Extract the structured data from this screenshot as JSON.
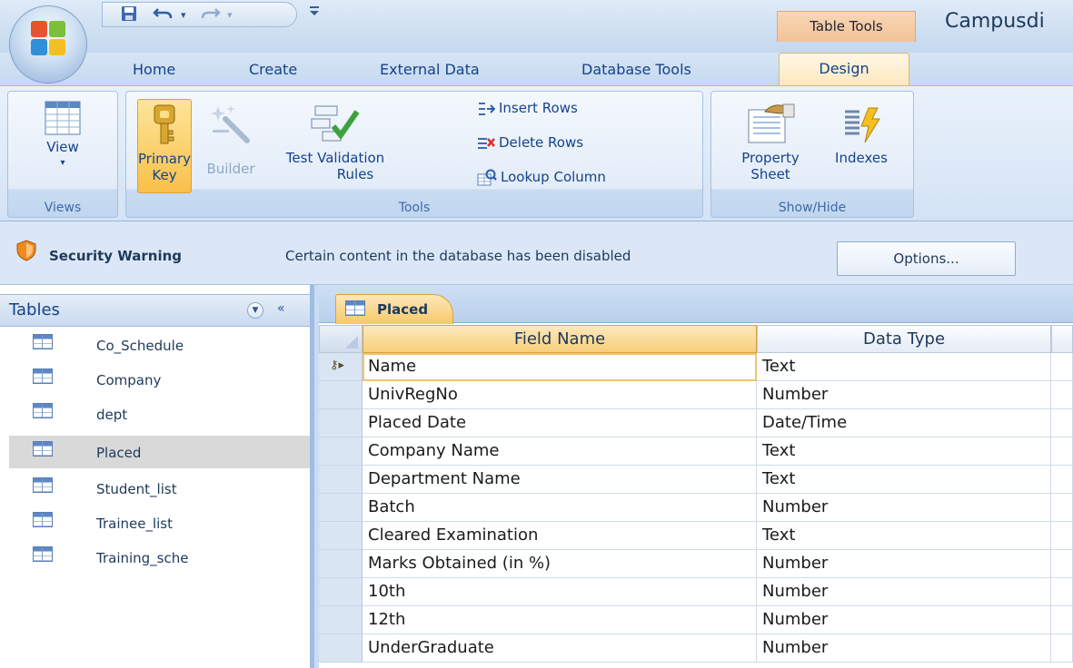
{
  "titlebar": {
    "contextual_tab": "Table Tools",
    "title": "Campusdi",
    "qat": {
      "save_icon": "save-icon",
      "undo_icon": "undo-icon",
      "redo_icon": "redo-icon",
      "customize_icon": "customize-qat-icon"
    }
  },
  "tabs": [
    {
      "label": "Home"
    },
    {
      "label": "Create"
    },
    {
      "label": "External Data"
    },
    {
      "label": "Database Tools"
    },
    {
      "label": "Design",
      "active": true
    }
  ],
  "ribbon": {
    "views": {
      "label": "Views",
      "view": "View"
    },
    "tools": {
      "label": "Tools",
      "primary_key_1": "Primary",
      "primary_key_2": "Key",
      "builder": "Builder",
      "test_validation_1": "Test Validation",
      "test_validation_2": "Rules",
      "insert_rows": "Insert Rows",
      "delete_rows": "Delete Rows",
      "lookup_column": "Lookup Column"
    },
    "showhide": {
      "label": "Show/Hide",
      "property_sheet_1": "Property",
      "property_sheet_2": "Sheet",
      "indexes": "Indexes"
    }
  },
  "security": {
    "title": "Security Warning",
    "message": "Certain content in the database has been disabled",
    "options": "Options..."
  },
  "nav": {
    "title": "Tables",
    "collapse": "«",
    "items": [
      {
        "label": "Co_Schedule"
      },
      {
        "label": "Company"
      },
      {
        "label": "dept"
      },
      {
        "label": "Placed",
        "selected": true
      },
      {
        "label": "Student_list"
      },
      {
        "label": "Trainee_list"
      },
      {
        "label": "Training_sche"
      }
    ]
  },
  "document": {
    "tab": "Placed",
    "headers": {
      "field_name": "Field Name",
      "data_type": "Data Type"
    },
    "rows": [
      {
        "field": "Name",
        "type": "Text",
        "primary_key": true
      },
      {
        "field": "UnivRegNo",
        "type": "Number"
      },
      {
        "field": "Placed Date",
        "type": "Date/Time"
      },
      {
        "field": "Company Name",
        "type": "Text"
      },
      {
        "field": "Department Name",
        "type": "Text"
      },
      {
        "field": "Batch",
        "type": "Number"
      },
      {
        "field": "Cleared Examination",
        "type": "Text"
      },
      {
        "field": "Marks Obtained (in %)",
        "type": "Number"
      },
      {
        "field": "10th",
        "type": "Number"
      },
      {
        "field": "12th",
        "type": "Number"
      },
      {
        "field": "UnderGraduate",
        "type": "Number"
      }
    ]
  },
  "colors": {
    "accent": "#15428b",
    "highlight": "#f9c04a",
    "ribbon_bg": "#d3e3f5"
  }
}
